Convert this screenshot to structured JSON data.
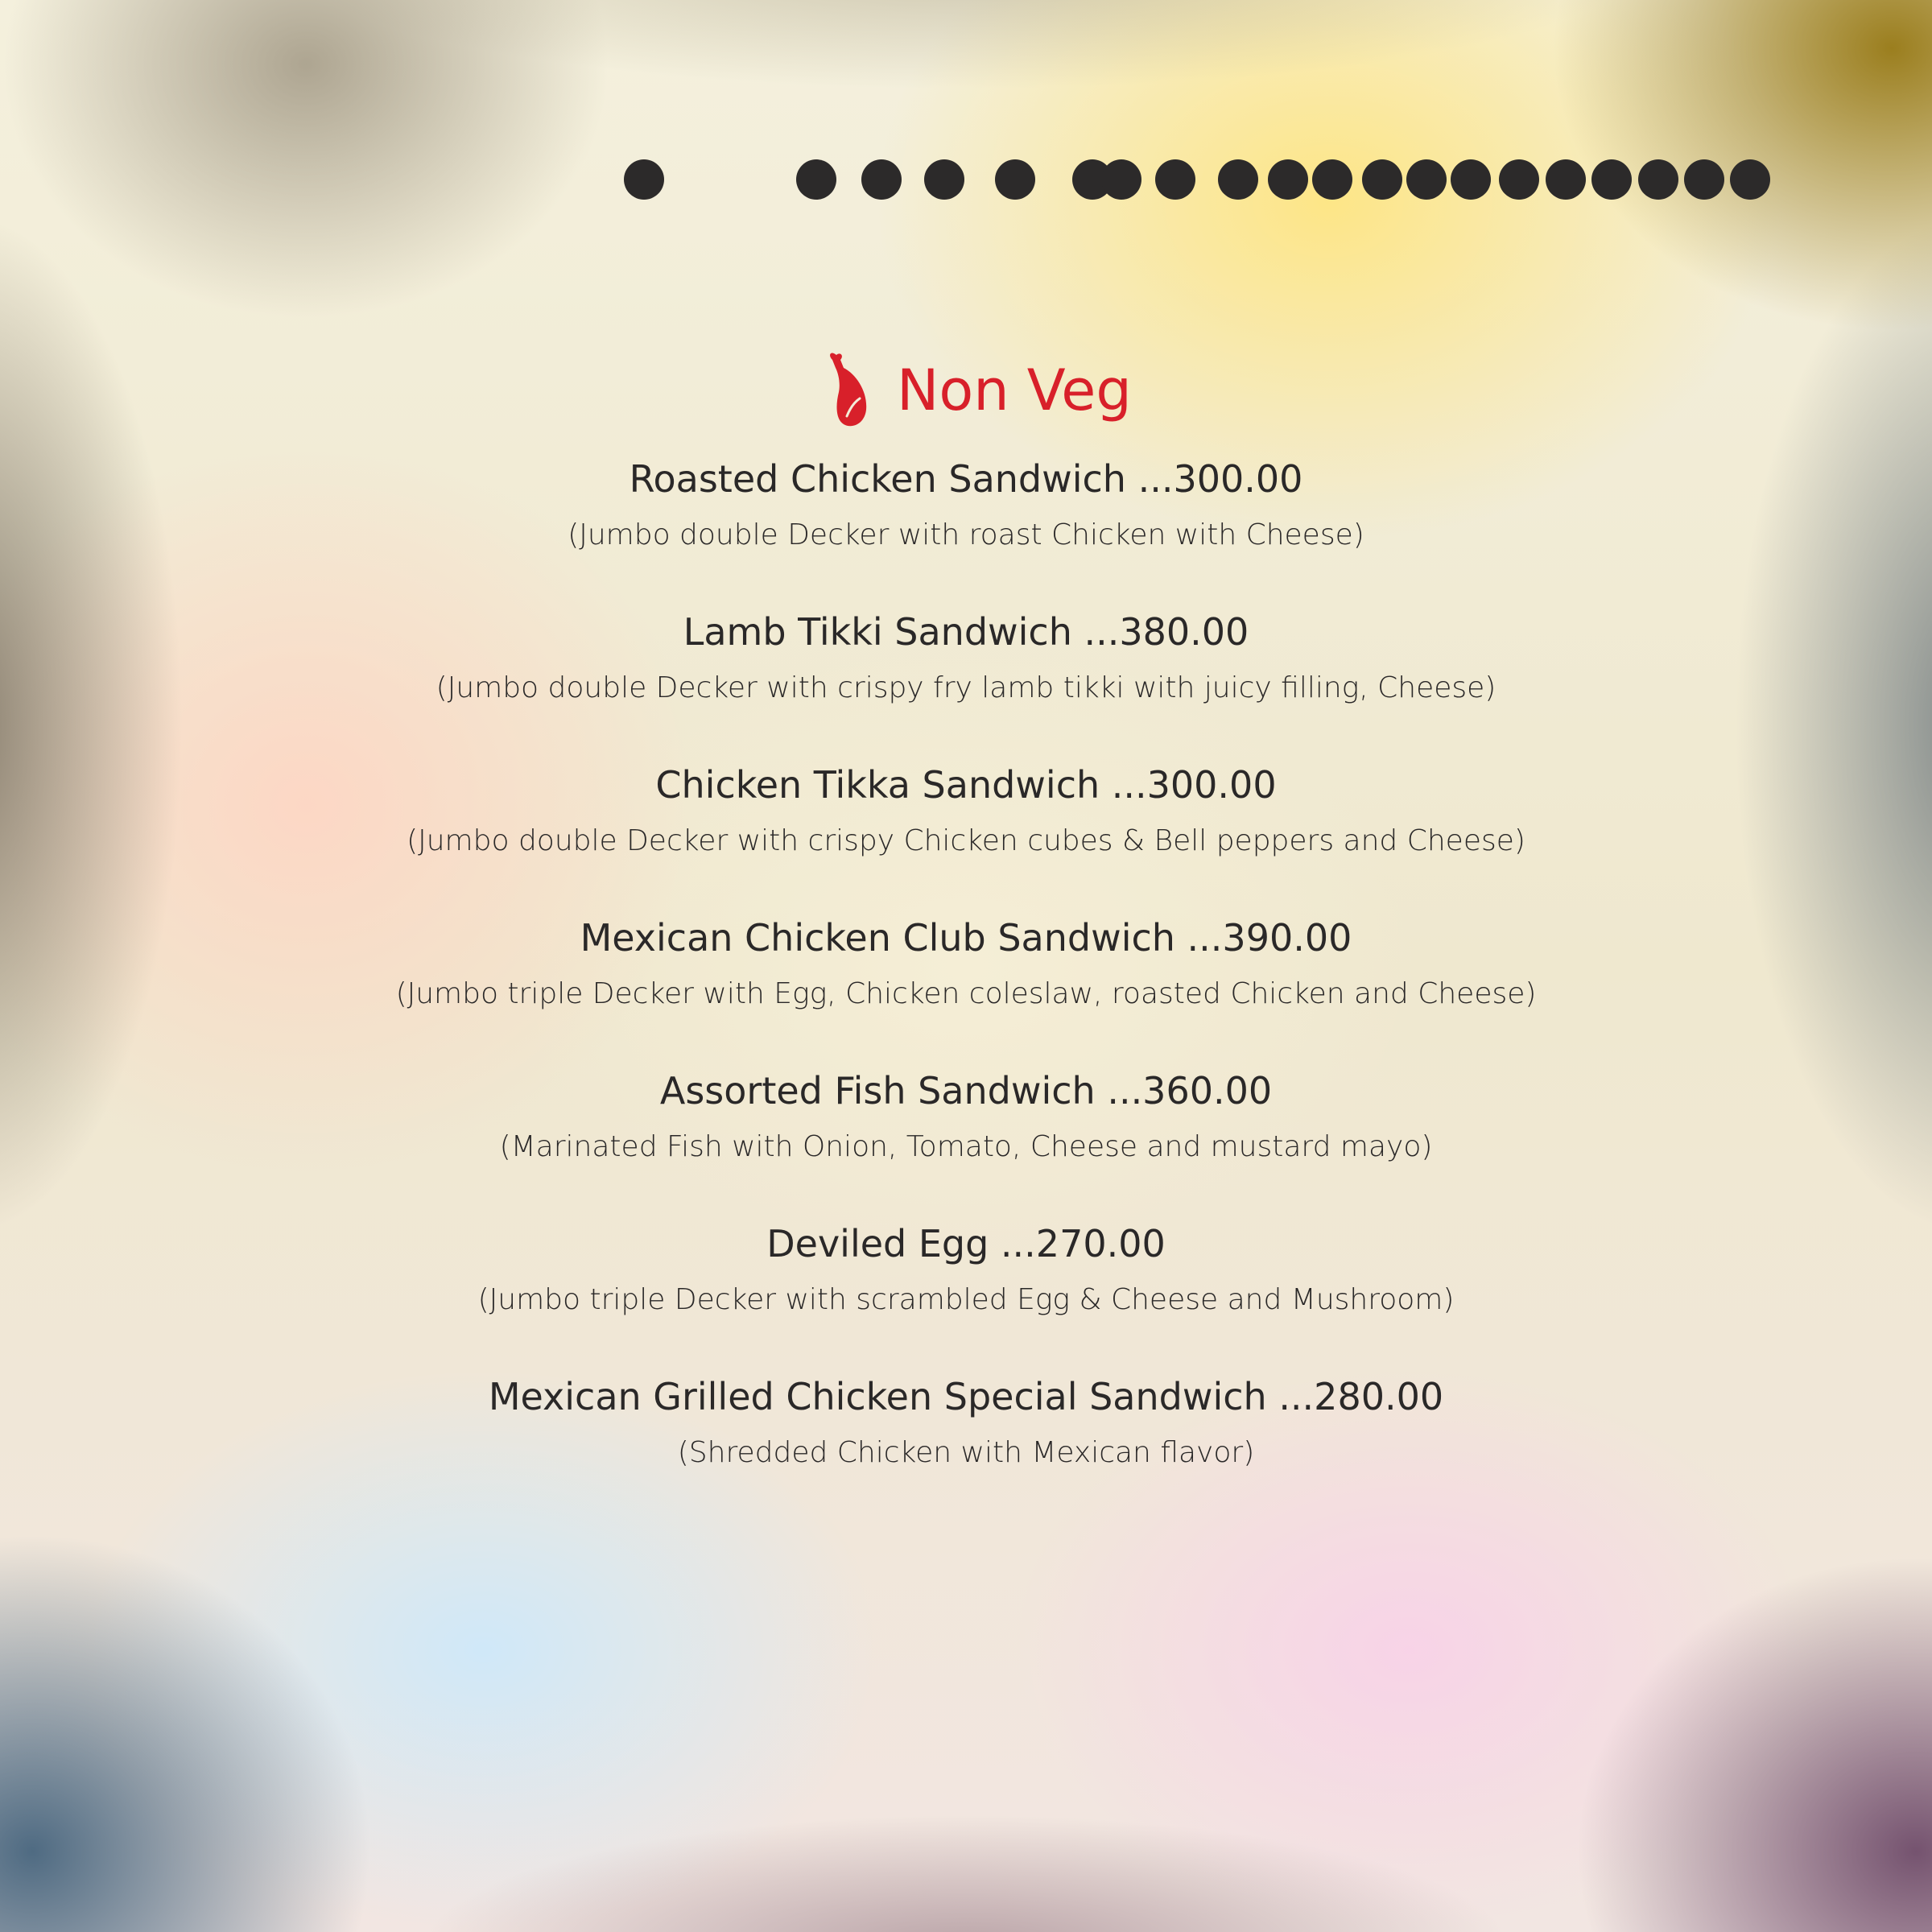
{
  "heading": {
    "icon": "drumstick-icon",
    "text": "Non Veg",
    "color": "#d8202a"
  },
  "items": [
    {
      "title": "Roasted Chicken Sandwich ...300.00",
      "description": "(Jumbo double Decker with roast Chicken with Cheese)"
    },
    {
      "title": "Lamb Tikki Sandwich ...380.00",
      "description": "(Jumbo double Decker with crispy fry lamb tikki with juicy filling, Cheese)"
    },
    {
      "title": "Chicken Tikka Sandwich ...300.00",
      "description": "(Jumbo double Decker with crispy Chicken cubes & Bell peppers and Cheese)"
    },
    {
      "title": "Mexican Chicken Club Sandwich ...390.00",
      "description": "(Jumbo triple Decker with Egg, Chicken coleslaw, roasted Chicken and Cheese)"
    },
    {
      "title": "Assorted Fish Sandwich ...360.00",
      "description": "(Marinated Fish with Onion, Tomato, Cheese and mustard mayo)"
    },
    {
      "title": "Deviled Egg ...270.00",
      "description": "(Jumbo triple Decker with scrambled Egg & Cheese and Mushroom)"
    },
    {
      "title": "Mexican Grilled Chicken Special Sandwich ...280.00",
      "description": "(Shredded Chicken with Mexican flavor)"
    }
  ],
  "text_color": "#2a2828",
  "dot_color": "#2c2a2a"
}
